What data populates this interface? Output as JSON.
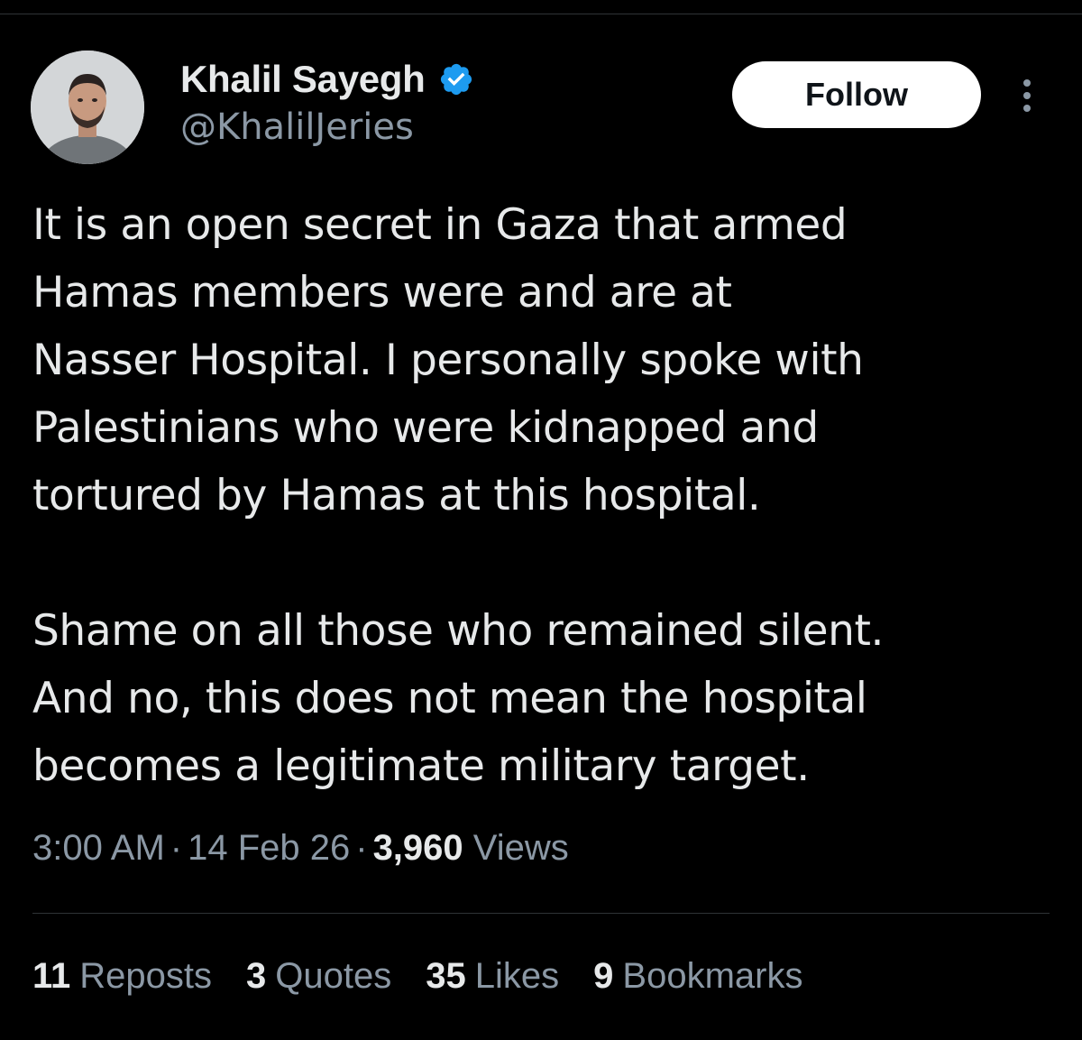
{
  "author": {
    "display_name": "Khalil Sayegh",
    "handle": "@KhalilJeries",
    "verified": true,
    "verified_color": "#1d9bf0"
  },
  "follow_button": {
    "label": "Follow"
  },
  "more_icon": "more-horizontal-icon",
  "tweet": {
    "paragraphs": [
      "It is an open secret in Gaza that armed\nHamas members were and are at\nNasser Hospital. I personally spoke with\nPalestinians who were kidnapped and\ntortured by Hamas at this hospital.",
      "Shame on all those who remained silent.\nAnd no, this does not mean the hospital\nbecomes a legitimate military target."
    ]
  },
  "meta": {
    "time": "3:00 AM",
    "separator": "·",
    "date": "14 Feb 26",
    "views_count": "3,960",
    "views_label": "Views"
  },
  "stats": [
    {
      "count": "11",
      "label": "Reposts"
    },
    {
      "count": "3",
      "label": "Quotes"
    },
    {
      "count": "35",
      "label": "Likes"
    },
    {
      "count": "9",
      "label": "Bookmarks"
    }
  ],
  "colors": {
    "background": "#000000",
    "text_primary": "#e7e9ea",
    "text_secondary": "#8b98a5",
    "divider": "#2f3336",
    "follow_bg": "#ffffff"
  }
}
